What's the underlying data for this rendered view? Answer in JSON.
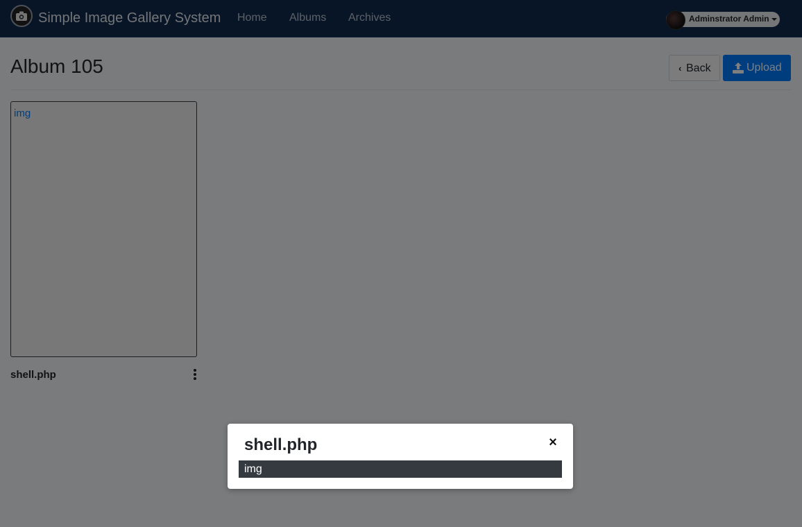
{
  "app": {
    "title": "Simple Image Gallery System"
  },
  "nav": {
    "items": [
      {
        "label": "Home"
      },
      {
        "label": "Albums"
      },
      {
        "label": "Archives"
      }
    ],
    "user": {
      "name": "Adminstrator Admin"
    }
  },
  "page": {
    "title": "Album 105",
    "back_label": "Back",
    "upload_label": "Upload"
  },
  "gallery": {
    "items": [
      {
        "image_alt": "img",
        "name": "shell.php"
      }
    ]
  },
  "modal": {
    "title": "shell.php",
    "close_symbol": "×",
    "image_alt": "img"
  },
  "colors": {
    "navbar": "#0e2a4f",
    "primary": "#007bff",
    "modal_body": "#343a40"
  }
}
